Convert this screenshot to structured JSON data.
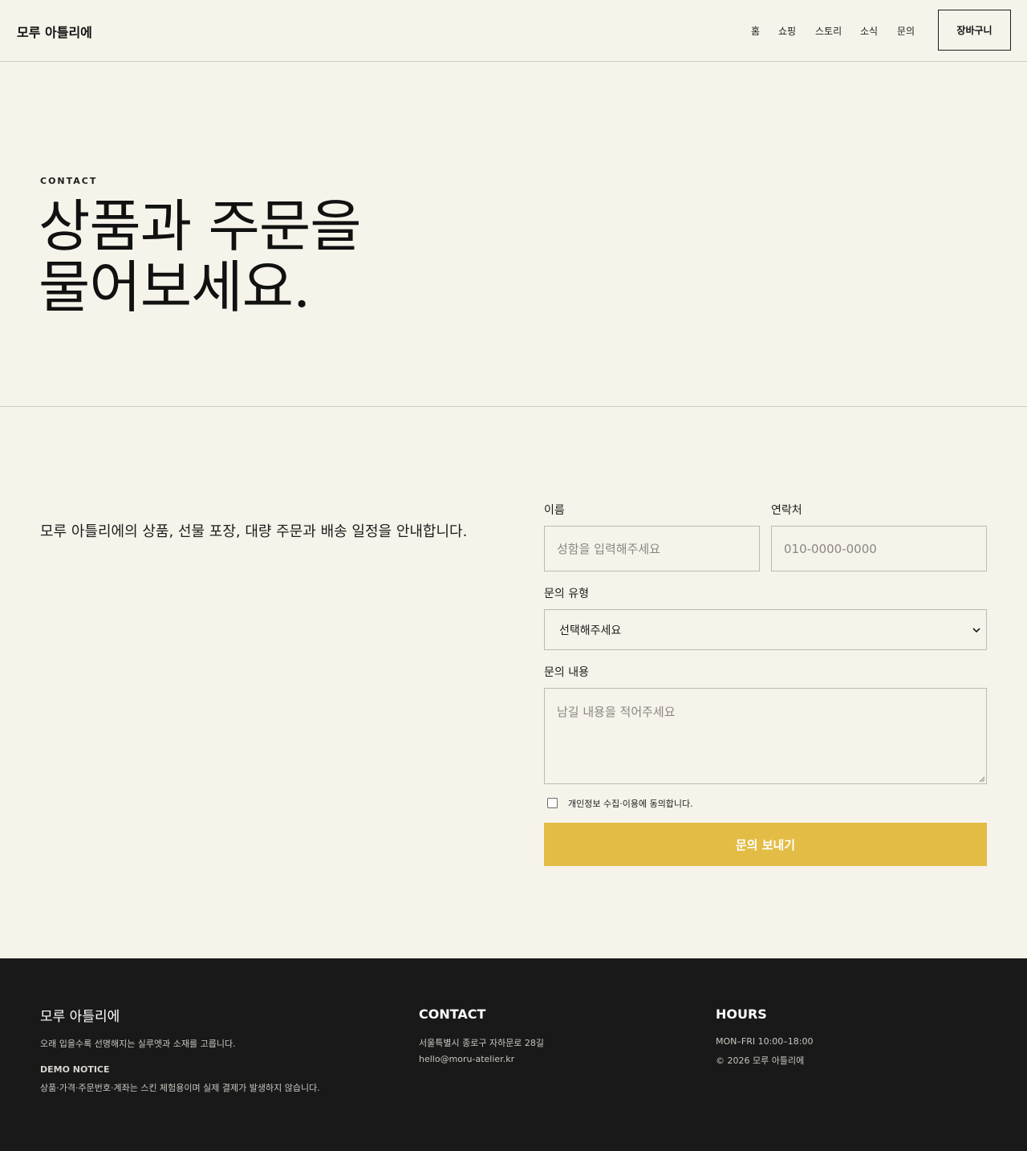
{
  "header": {
    "logo": "모루 아틀리에",
    "nav": [
      "홈",
      "쇼핑",
      "스토리",
      "소식",
      "문의"
    ],
    "cart_label": "장바구니"
  },
  "hero": {
    "eyebrow": "CONTACT",
    "title_line1": "상품과 주문을",
    "title_line2": "물어보세요."
  },
  "intro": {
    "text": "모루 아틀리에의 상품, 선물 포장, 대량 주문과 배송 일정을 안내합니다."
  },
  "form": {
    "name_label": "이름",
    "name_placeholder": "성함을 입력해주세요",
    "phone_label": "연락처",
    "phone_placeholder": "010-0000-0000",
    "type_label": "문의 유형",
    "type_selected": "선택해주세요",
    "message_label": "문의 내용",
    "message_placeholder": "남길 내용을 적어주세요",
    "consent_label": "개인정보 수집·이용에 동의합니다.",
    "consent_checked": false,
    "submit_label": "문의 보내기"
  },
  "footer": {
    "logo": "모루 아틀리에",
    "tagline": "오래 입을수록 선명해지는 실루엣과 소재를 고릅니다.",
    "notice_title": "DEMO NOTICE",
    "notice_text": "상품·가격·주문번호·계좌는 스킨 체험용이며 실제 결제가 발생하지 않습니다.",
    "contact_title": "CONTACT",
    "address": "서울특별시 종로구 자하문로 28길",
    "email": "hello@moru-atelier.kr",
    "hours_title": "HOURS",
    "hours": "MON–FRI 10:00–18:00",
    "copyright": "© 2026 모루 아틀리에"
  },
  "colors": {
    "background": "#f6f3ea",
    "accent": "#e2bc44",
    "footer_bg": "#191919",
    "text": "#1c1c1c"
  }
}
